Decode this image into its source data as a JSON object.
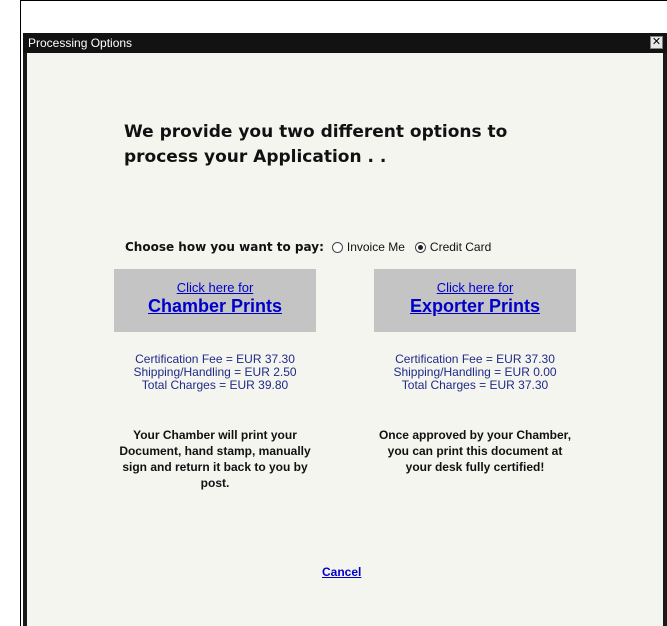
{
  "dialog": {
    "title": "Processing Options",
    "close_glyph": "✕"
  },
  "main": {
    "heading": "We provide you two different options to process your Application . .",
    "pay_label": "Choose how you want to pay:",
    "payment_options": [
      {
        "label": "Invoice Me",
        "selected": false
      },
      {
        "label": "Credit Card",
        "selected": true
      }
    ],
    "options": [
      {
        "small": "Click here for",
        "big": "Chamber Prints",
        "fees": [
          "Certification Fee = EUR 37.30",
          "Shipping/Handling = EUR 2.50",
          "Total Charges = EUR 39.80"
        ],
        "description": "Your Chamber will print your Document, hand stamp, manually sign and return it back to you by post."
      },
      {
        "small": "Click here for",
        "big": "Exporter Prints",
        "fees": [
          "Certification Fee = EUR 37.30",
          "Shipping/Handling = EUR 0.00",
          "Total Charges = EUR 37.30"
        ],
        "description": "Once approved by your Chamber, you can print this document at your desk fully certified!"
      }
    ],
    "cancel_label": "Cancel"
  },
  "icons": {
    "close": "close-icon"
  }
}
